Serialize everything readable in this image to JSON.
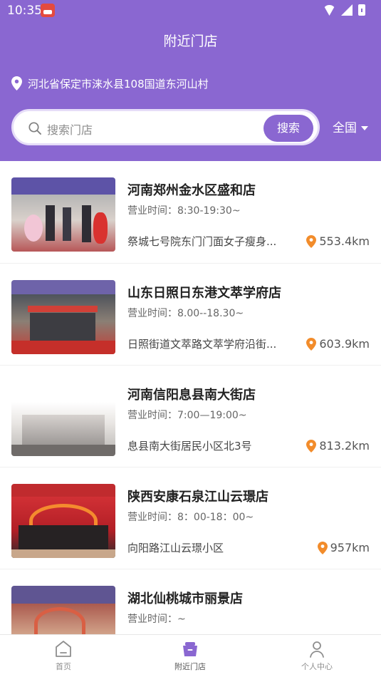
{
  "status": {
    "time": "10:35",
    "wifi_icon": "wifi-icon",
    "signal_icon": "signal-icon",
    "battery_icon": "battery-icon"
  },
  "header": {
    "title": "附近门店",
    "location": "河北省保定市涞水县108国道东河山村",
    "search_placeholder": "搜索门店",
    "search_button": "搜索",
    "region": "全国"
  },
  "stores": [
    {
      "name": "河南郑州金水区盛和店",
      "hours": "营业时间：8:30-19:30~",
      "address": "祭城七号院东门门面女子瘦身...",
      "distance": "553.4km"
    },
    {
      "name": "山东日照日东港文萃学府店",
      "hours": "营业时间：8.00--18.30~",
      "address": "日照街道文萃路文萃学府沿街...",
      "distance": "603.9km"
    },
    {
      "name": "河南信阳息县南大街店",
      "hours": "营业时间：7:00—19:00~",
      "address": "息县南大街居民小区北3号",
      "distance": "813.2km"
    },
    {
      "name": "陕西安康石泉江山云璟店",
      "hours": "营业时间：8：00-18：00~",
      "address": "向阳路江山云璟小区",
      "distance": "957km"
    },
    {
      "name": "湖北仙桃城市丽景店",
      "hours": "营业时间：~",
      "address": "",
      "distance": ""
    }
  ],
  "tabs": [
    {
      "label": "首页",
      "icon": "home-icon"
    },
    {
      "label": "附近门店",
      "icon": "store-icon"
    },
    {
      "label": "个人中心",
      "icon": "user-icon"
    }
  ],
  "colors": {
    "primary": "#8a67d1",
    "accent": "#f28c2b",
    "text": "#222222"
  }
}
